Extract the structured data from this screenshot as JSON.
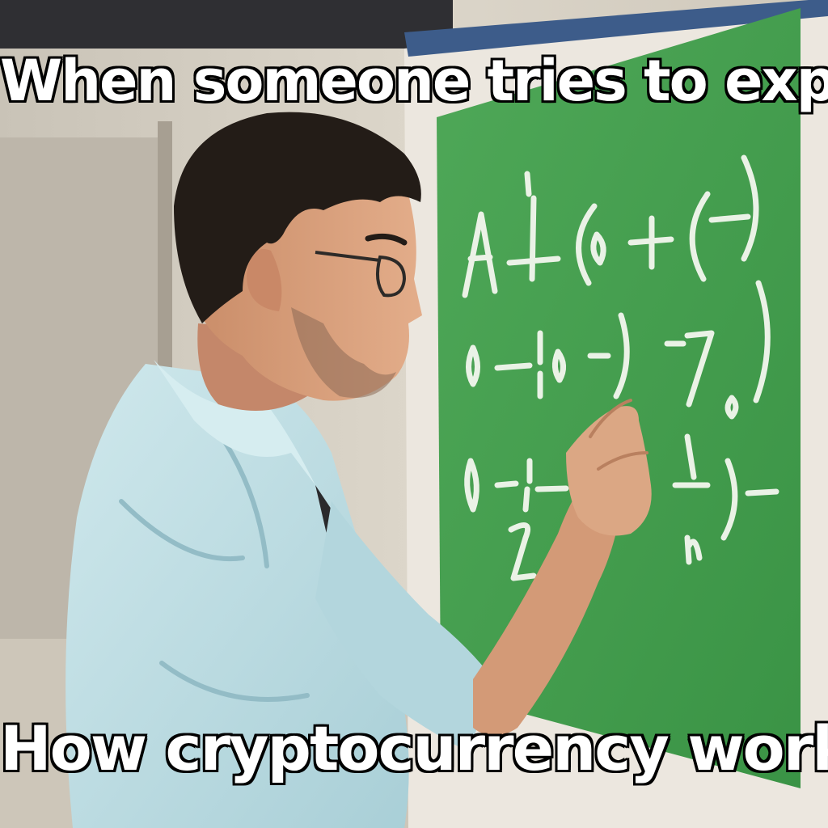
{
  "meme": {
    "top_text": "When someone tries to explain",
    "bottom_text": "How cryptocurrency works"
  },
  "colors": {
    "board_green": "#3f9a4a",
    "board_frame": "#ece7df",
    "wall": "#d8d2c6",
    "shirt": "#bcdde3",
    "hair": "#231c17",
    "skin": "#d9a07c",
    "caption_fill": "#ffffff",
    "caption_outline": "#000000"
  }
}
